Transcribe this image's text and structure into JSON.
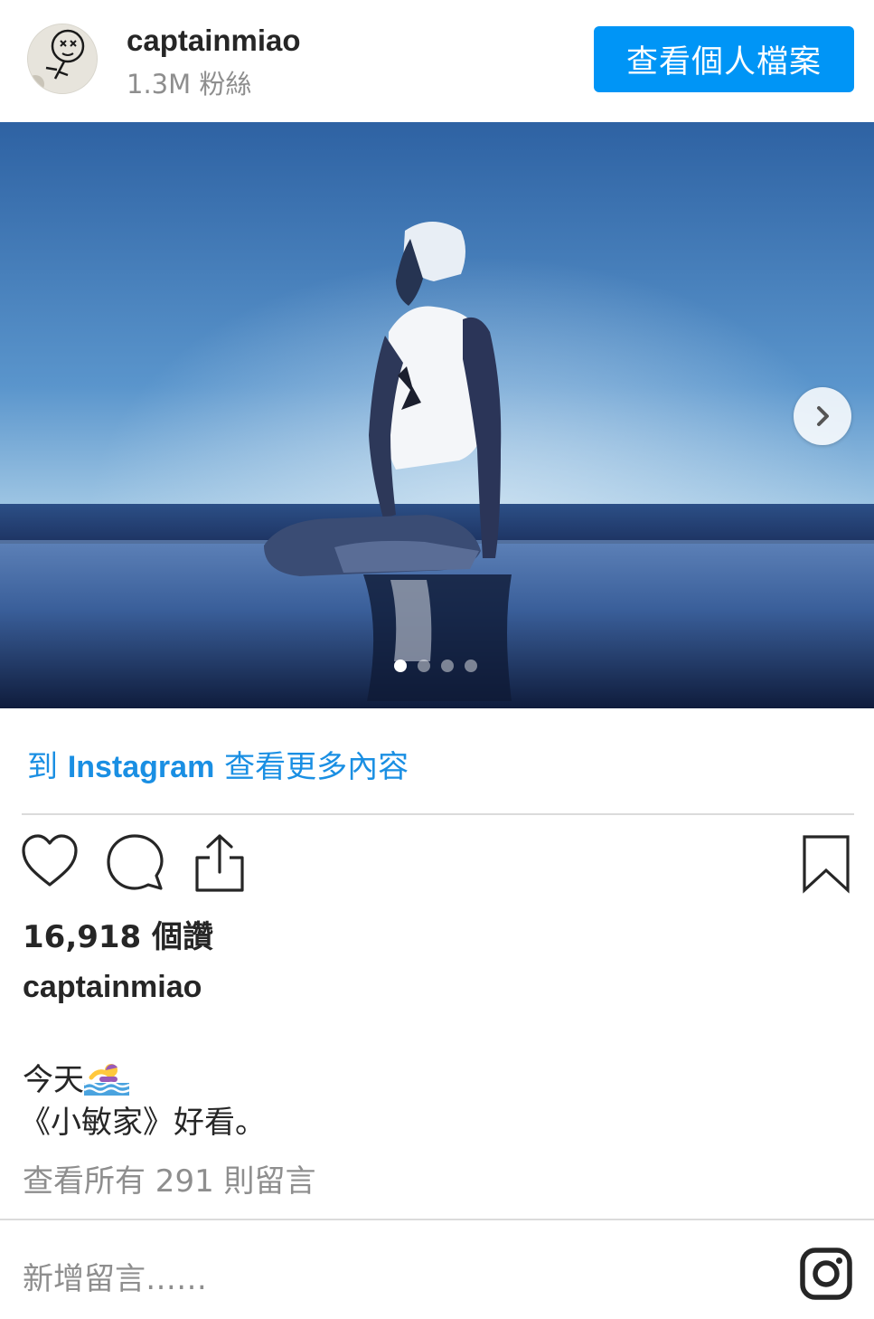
{
  "header": {
    "username": "captainmiao",
    "followers": "1.3M 粉絲",
    "view_profile_label": "查看個人檔案"
  },
  "carousel": {
    "slide_count": 4,
    "active_index": 0
  },
  "link": {
    "prefix": "到 ",
    "brand": "Instagram",
    "suffix": " 查看更多內容"
  },
  "post": {
    "likes": "16,918 個讚",
    "caption_username": "captainmiao",
    "caption_line1": "今天",
    "caption_emoji": "swimmer-emoji",
    "caption_line2": "《小敏家》好看。",
    "view_comments": "查看所有 291 則留言"
  },
  "comment_box": {
    "placeholder": "新增留言……"
  },
  "icons": [
    "heart-icon",
    "comment-icon",
    "share-icon",
    "bookmark-icon",
    "instagram-icon",
    "chevron-right-icon"
  ],
  "colors": {
    "accent": "#0095f6",
    "link": "#1a8fe3",
    "text": "#262626",
    "muted": "#8e8e8e"
  }
}
